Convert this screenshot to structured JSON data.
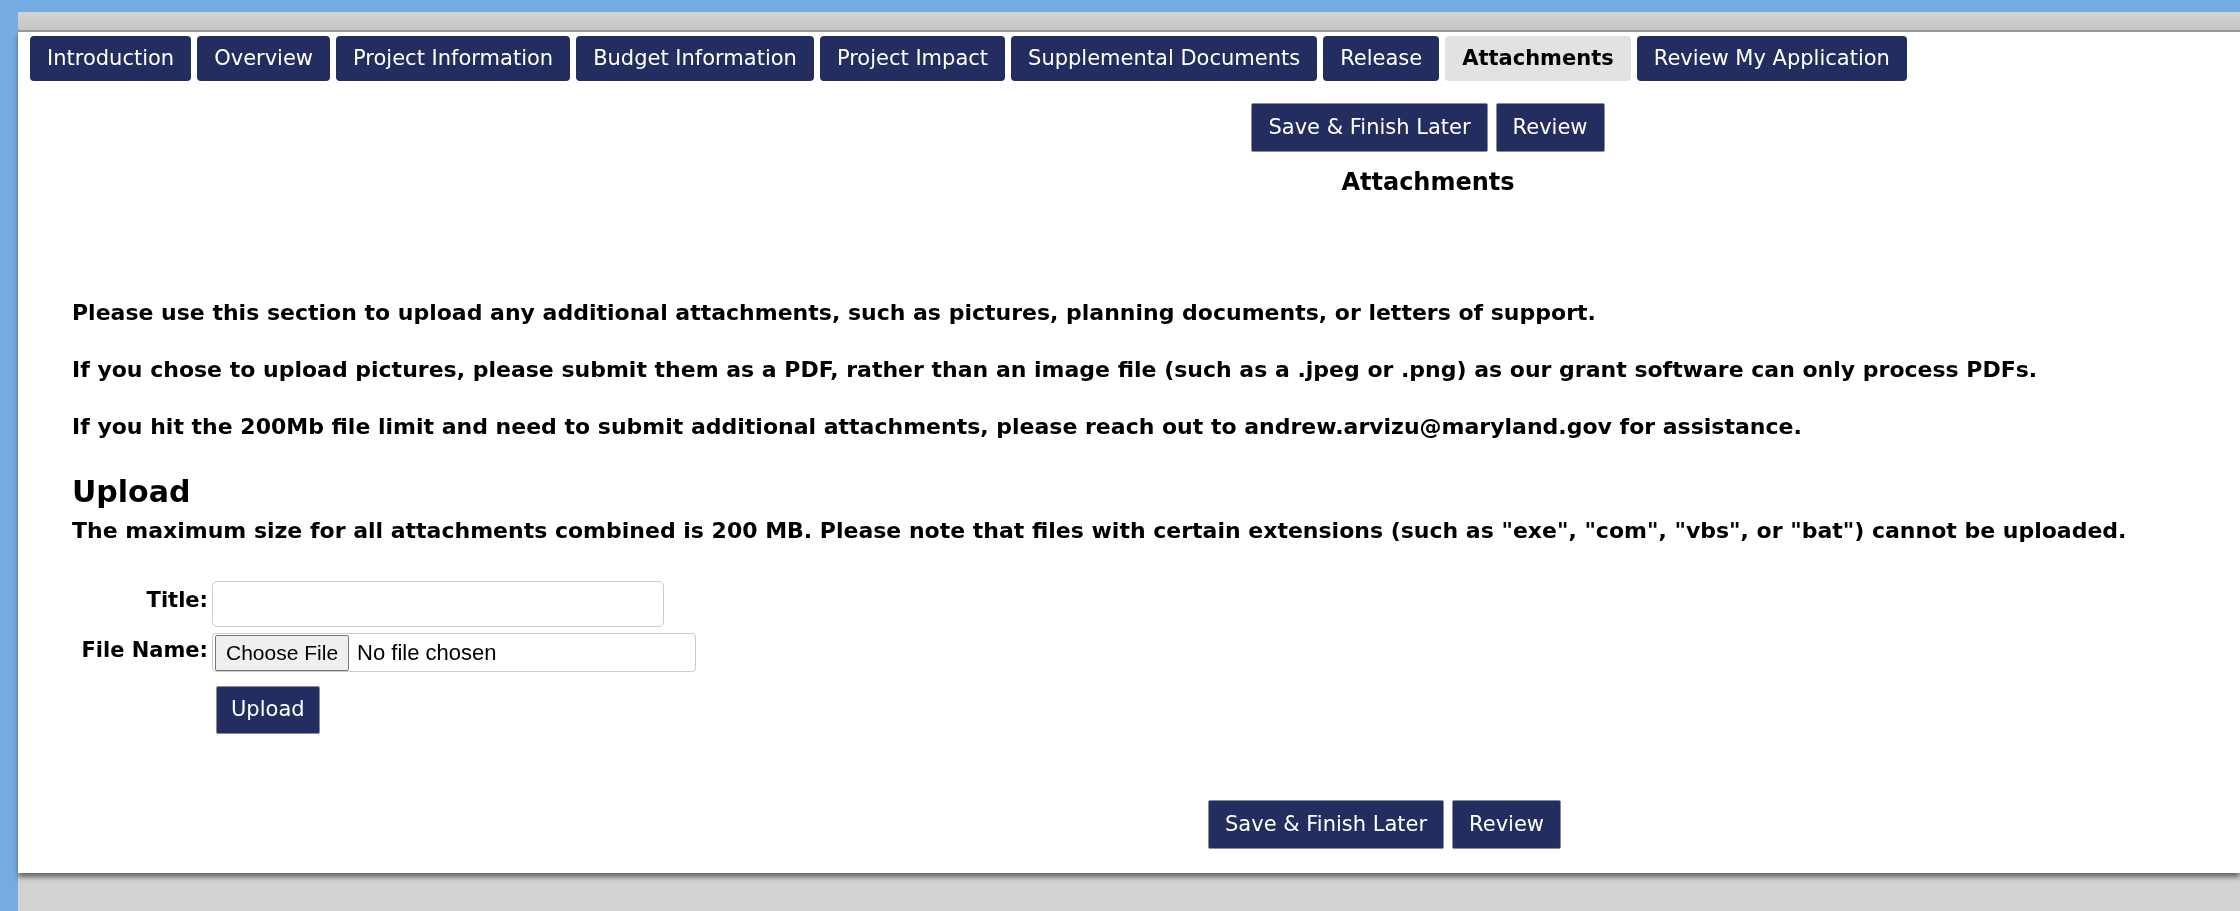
{
  "tabs": [
    {
      "label": "Introduction",
      "selected": false
    },
    {
      "label": "Overview",
      "selected": false
    },
    {
      "label": "Project Information",
      "selected": false
    },
    {
      "label": "Budget Information",
      "selected": false
    },
    {
      "label": "Project Impact",
      "selected": false
    },
    {
      "label": "Supplemental Documents",
      "selected": false
    },
    {
      "label": "Release",
      "selected": false
    },
    {
      "label": "Attachments",
      "selected": true
    },
    {
      "label": "Review My Application",
      "selected": false
    }
  ],
  "top_actions": [
    "Save & Finish Later",
    "Review"
  ],
  "heading": "Attachments",
  "instructions": [
    "Please use this section to upload any additional attachments, such as pictures, planning documents, or letters of support.",
    "If you chose to upload pictures, please submit them as a PDF, rather than an image file (such as a .jpeg or .png) as our grant software can only process PDFs.",
    "If you hit the 200Mb file limit and need to submit additional attachments, please reach out to andrew.arvizu@maryland.gov for assistance."
  ],
  "upload": {
    "title": "Upload",
    "note": "The maximum size for all attachments combined is 200 MB. Please note that files with certain extensions (such as \"exe\", \"com\", \"vbs\", or \"bat\") cannot be uploaded.",
    "title_label": "Title:",
    "file_label": "File Name:",
    "choose_button": "Choose File",
    "file_status": "No file chosen",
    "submit": "Upload"
  },
  "bottom_actions": [
    "Save & Finish Later",
    "Review"
  ]
}
